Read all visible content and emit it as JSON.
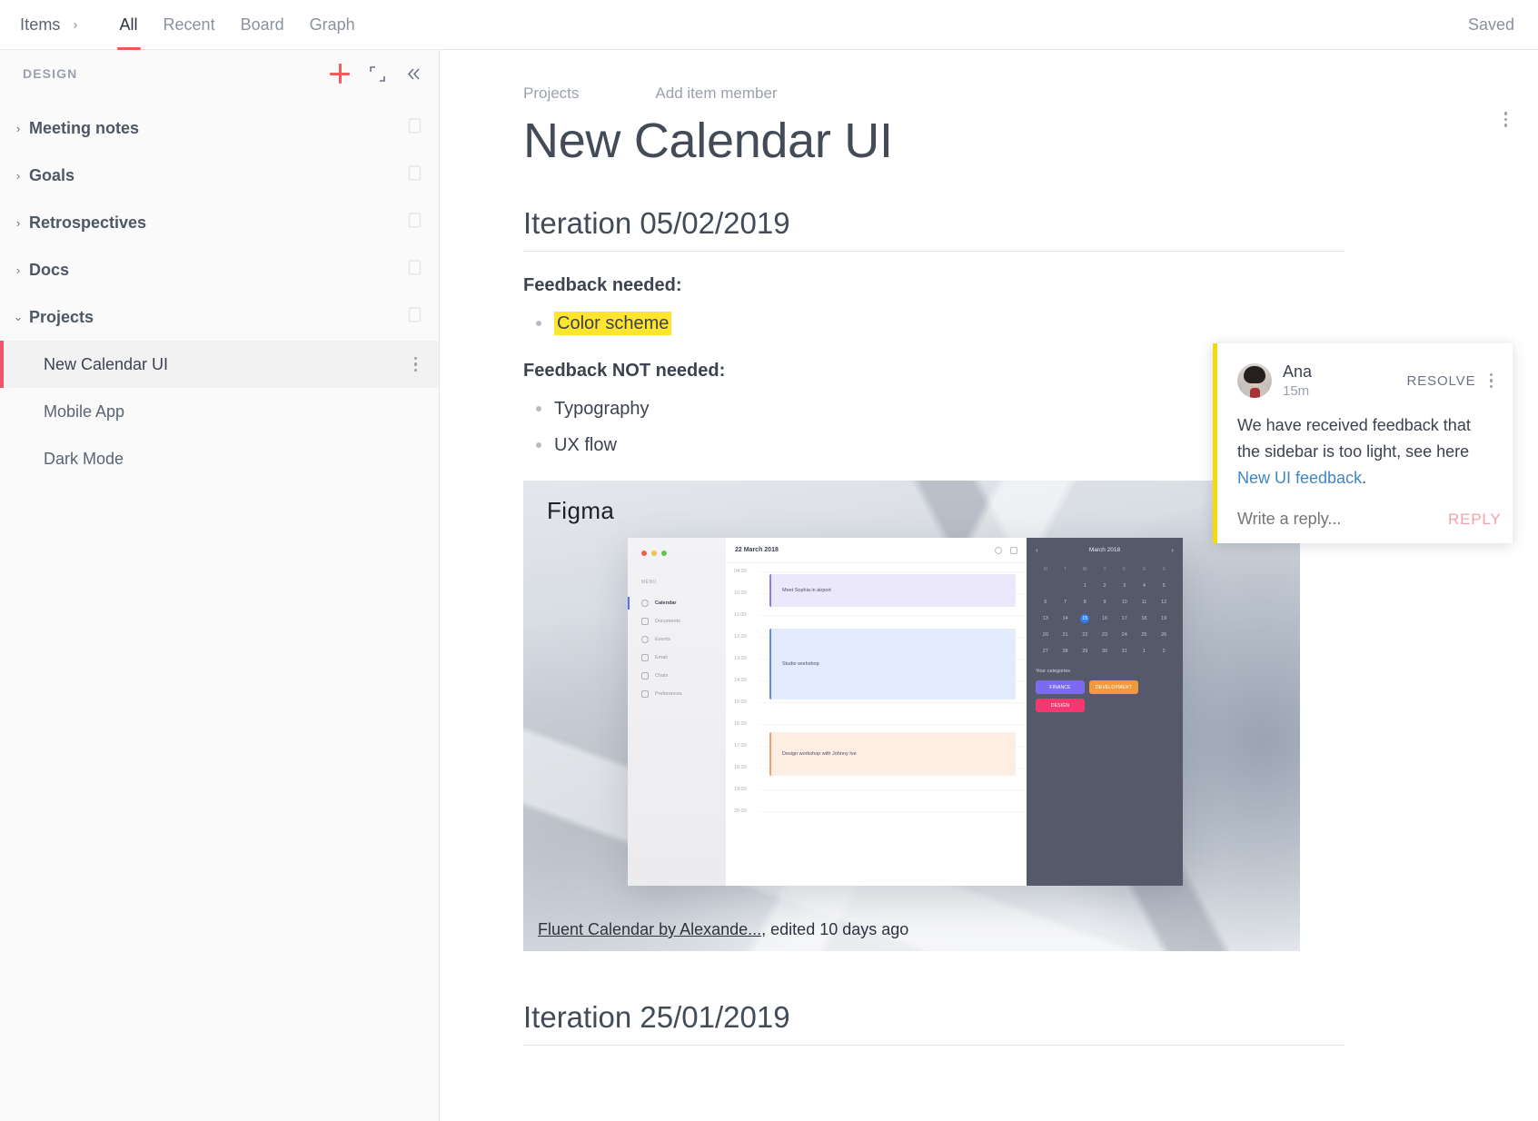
{
  "topbar": {
    "items_label": "Items",
    "caret": "›",
    "tabs": [
      {
        "label": "All",
        "active": true
      },
      {
        "label": "Recent",
        "active": false
      },
      {
        "label": "Board",
        "active": false
      },
      {
        "label": "Graph",
        "active": false
      }
    ],
    "status": "Saved"
  },
  "sidebar": {
    "title": "DESIGN",
    "actions": {
      "add": "+",
      "expand": "expand-icon",
      "collapse": "«"
    },
    "groups": [
      {
        "label": "Meeting notes",
        "chevron": "›",
        "expanded": false
      },
      {
        "label": "Goals",
        "chevron": "›",
        "expanded": false
      },
      {
        "label": "Retrospectives",
        "chevron": "›",
        "expanded": false
      },
      {
        "label": "Docs",
        "chevron": "›",
        "expanded": false
      },
      {
        "label": "Projects",
        "chevron": "⌄",
        "expanded": true
      }
    ],
    "children": [
      {
        "label": "New Calendar UI",
        "active": true
      },
      {
        "label": "Mobile App",
        "active": false
      },
      {
        "label": "Dark Mode",
        "active": false
      }
    ]
  },
  "main": {
    "breadcrumb": "Projects",
    "add_member": "Add item member",
    "title": "New Calendar UI",
    "sections": [
      {
        "heading": "Iteration 05/02/2019",
        "needed_label": "Feedback needed:",
        "needed_items": [
          "Color scheme"
        ],
        "not_needed_label": "Feedback NOT needed:",
        "not_needed_items": [
          "Typography",
          "UX flow"
        ]
      },
      {
        "heading": "Iteration 25/01/2019"
      }
    ],
    "embed": {
      "label": "Figma",
      "caption_link": "Fluent Calendar by Alexande...",
      "caption_rest": ", edited 10 days ago",
      "mock": {
        "menu_header": "MENU",
        "menu_items": [
          "Calendar",
          "Documents",
          "Events",
          "Email",
          "Chats",
          "Preferences"
        ],
        "date": "22 March 2018",
        "hours": [
          "04:00",
          "10:00",
          "11:00",
          "12:00",
          "13:00",
          "14:00",
          "15:00",
          "16:00",
          "17:00",
          "18:00",
          "19:00",
          "20:00"
        ],
        "events": [
          {
            "title": "Meet Sophia in airport",
            "color": "#8b7bf0"
          },
          {
            "title": "Studio workshop",
            "color": "#5b8df5"
          },
          {
            "title": "Design workshop with Johnny Ive",
            "color": "#f0a06a"
          }
        ],
        "month": "March 2018",
        "weekdays": [
          "M",
          "T",
          "W",
          "T",
          "F",
          "S",
          "S"
        ],
        "days": [
          "1",
          "2",
          "3",
          "4",
          "5",
          "6",
          "7",
          "8",
          "9",
          "10",
          "11",
          "12",
          "13",
          "14",
          "15",
          "16",
          "17",
          "18",
          "19",
          "20",
          "21",
          "22",
          "23",
          "24",
          "25",
          "26",
          "27",
          "28",
          "29",
          "30",
          "31",
          "1",
          "2"
        ],
        "today": "15",
        "categories_label": "Your categories",
        "chips": [
          {
            "label": "FINANCE",
            "color": "#7c6af0"
          },
          {
            "label": "DEVELOPMENT",
            "color": "#ef9a3c"
          },
          {
            "label": "DESIGN",
            "color": "#f5386f"
          }
        ]
      }
    }
  },
  "comment": {
    "author": "Ana",
    "time": "15m",
    "resolve_label": "RESOLVE",
    "body_pre": "We have received feedback that the sidebar is too light, see here ",
    "body_link": "New UI feedback",
    "body_post": ".",
    "reply_placeholder": "Write a reply...",
    "reply_label": "REPLY"
  },
  "colors": {
    "accent_red": "#ef5656",
    "selected_bar": "#f2556b",
    "highlight_yellow": "#ffe52e",
    "comment_border": "#f5d90a",
    "link_blue": "#3f87c4",
    "reply_pink": "#f2a0ad"
  }
}
